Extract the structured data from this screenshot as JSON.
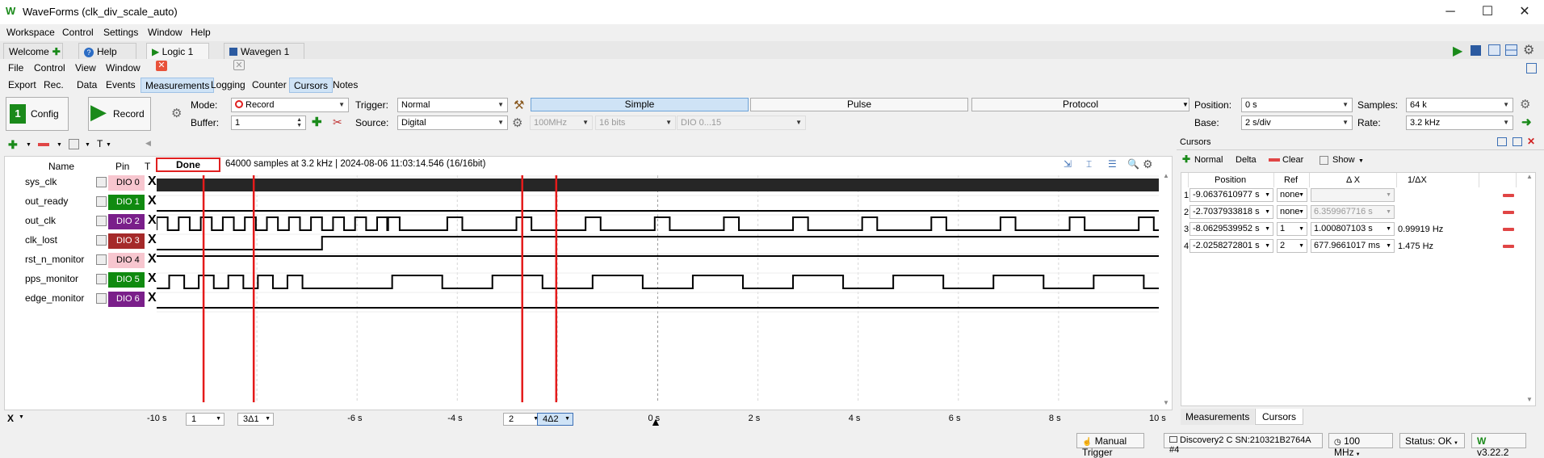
{
  "window": {
    "title": "WaveForms (clk_div_scale_auto)",
    "minimize": "─",
    "maximize": "☐",
    "close": "✕"
  },
  "menubar1": [
    "Workspace",
    "Control",
    "Settings",
    "Window",
    "Help"
  ],
  "tabs": [
    {
      "label": "Welcome"
    },
    {
      "label": "Help"
    },
    {
      "label": "Logic 1"
    },
    {
      "label": "Wavegen 1"
    }
  ],
  "menubar2": [
    "File",
    "Control",
    "View",
    "Window"
  ],
  "subtabs": [
    "Export",
    "Rec.",
    "Data",
    "Events",
    "Measurements",
    "Logging",
    "Counter",
    "Cursors",
    "Notes"
  ],
  "buttons": {
    "config": "Config",
    "record": "Record"
  },
  "mode": {
    "label": "Mode:",
    "value": "Record"
  },
  "buffer": {
    "label": "Buffer:",
    "value": "1"
  },
  "trigger": {
    "label": "Trigger:",
    "value": "Normal"
  },
  "source": {
    "label": "Source:",
    "value": "Digital"
  },
  "trig_modes": [
    "Simple",
    "Pulse",
    "Protocol"
  ],
  "disabled": {
    "freq": "100MHz",
    "bits": "16 bits",
    "dio": "DIO 0...15"
  },
  "position": {
    "label": "Position:",
    "value": "0 s"
  },
  "base": {
    "label": "Base:",
    "value": "2 s/div"
  },
  "samples": {
    "label": "Samples:",
    "value": "64 k"
  },
  "rate": {
    "label": "Rate:",
    "value": "3.2 kHz"
  },
  "left_toolbar": {
    "t_label": "T"
  },
  "table_head": {
    "name": "Name",
    "pin": "Pin",
    "t": "T"
  },
  "channels": [
    {
      "name": "sys_clk",
      "pin": "DIO 0",
      "color": "#f7c6cf",
      "text": "#000"
    },
    {
      "name": "out_ready",
      "pin": "DIO 1",
      "color": "#108a10",
      "text": "#fff"
    },
    {
      "name": "out_clk",
      "pin": "DIO 2",
      "color": "#7a1f8a",
      "text": "#fff"
    },
    {
      "name": "clk_lost",
      "pin": "DIO 3",
      "color": "#a52a2a",
      "text": "#fff"
    },
    {
      "name": "rst_n_monitor",
      "pin": "DIO 4",
      "color": "#f7c6cf",
      "text": "#000"
    },
    {
      "name": "pps_monitor",
      "pin": "DIO 5",
      "color": "#108a10",
      "text": "#fff"
    },
    {
      "name": "edge_monitor",
      "pin": "DIO 6",
      "color": "#7a1f8a",
      "text": "#fff"
    }
  ],
  "trig_mark": "X",
  "acq": {
    "state": "Done",
    "info": "64000 samples at 3.2 kHz | 2024-08-06 11:03:14.546 (16/16bit)"
  },
  "xaxis": {
    "ticks": [
      "-10 s",
      "-6 s",
      "-4 s",
      "0 s",
      "2 s",
      "4 s",
      "6 s",
      "8 s",
      "10 s"
    ],
    "x_label": "X",
    "c1": "1",
    "c1d": "3Δ1",
    "c2": "2",
    "c2d": "4Δ2"
  },
  "cursors_panel": {
    "title": "Cursors",
    "normal": "Normal",
    "delta": "Delta",
    "clear": "Clear",
    "show": "Show",
    "cols": [
      "Position",
      "Ref",
      "Δ X",
      "1/ΔX"
    ],
    "rows": [
      {
        "n": "1",
        "pos": "-9.0637610977 s",
        "ref": "none",
        "dx": "",
        "inv": ""
      },
      {
        "n": "2",
        "pos": "-2.7037933818 s",
        "ref": "none",
        "dx": "6.359967716 s",
        "inv": ""
      },
      {
        "n": "3",
        "pos": "-8.0629539952 s",
        "ref": "1",
        "dx": "1.000807103 s",
        "inv": "0.99919 Hz"
      },
      {
        "n": "4",
        "pos": "-2.0258272801 s",
        "ref": "2",
        "dx": "677.9661017 ms",
        "inv": "1.475 Hz"
      }
    ]
  },
  "bottom_tabs": [
    "Measurements",
    "Cursors"
  ],
  "statusbar": {
    "manual": "Manual Trigger",
    "device": "Discovery2 C SN:210321B2764A #4",
    "clock": "100 MHz",
    "status": "Status: OK",
    "version": "v3.22.2"
  },
  "colors": {
    "cursor": "#e41b1b",
    "accent": "#cfe3f6",
    "waveform": "#000000"
  }
}
